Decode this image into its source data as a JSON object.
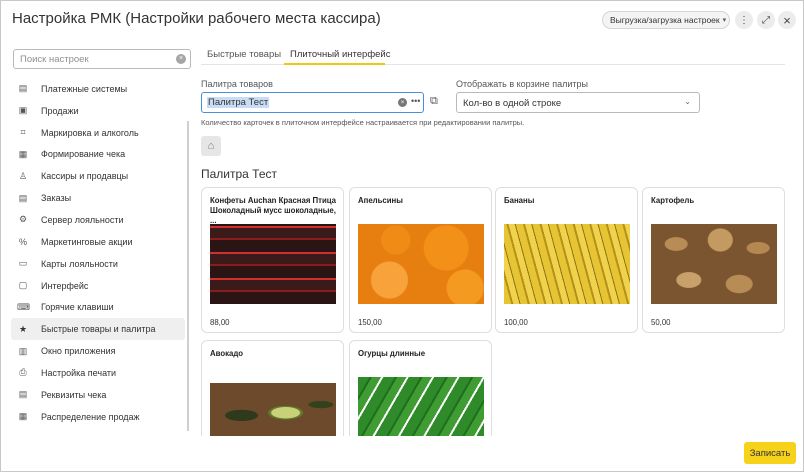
{
  "window": {
    "title": "Настройка РМК (Настройки рабочего места кассира)",
    "export_label": "Выгрузка/загрузка настроек",
    "more_icon": "more-vertical-icon",
    "expand_icon": "expand-icon",
    "close_icon": "close-icon"
  },
  "sidebar": {
    "search_placeholder": "Поиск настроек",
    "items": [
      {
        "label": "Платежные системы",
        "icon": "payment-systems-icon"
      },
      {
        "label": "Продажи",
        "icon": "sales-icon"
      },
      {
        "label": "Маркировка и алкоголь",
        "icon": "marking-icon"
      },
      {
        "label": "Формирование чека",
        "icon": "receipt-icon"
      },
      {
        "label": "Кассиры и продавцы",
        "icon": "cashiers-icon"
      },
      {
        "label": "Заказы",
        "icon": "orders-icon"
      },
      {
        "label": "Сервер лояльности",
        "icon": "gear-icon"
      },
      {
        "label": "Маркетинговые акции",
        "icon": "percent-icon"
      },
      {
        "label": "Карты лояльности",
        "icon": "card-icon"
      },
      {
        "label": "Интерфейс",
        "icon": "interface-icon"
      },
      {
        "label": "Горячие клавиши",
        "icon": "keyboard-icon"
      },
      {
        "label": "Быстрые товары и палитра",
        "icon": "star-icon"
      },
      {
        "label": "Окно приложения",
        "icon": "window-icon"
      },
      {
        "label": "Настройка печати",
        "icon": "printer-icon"
      },
      {
        "label": "Реквизиты чека",
        "icon": "receipt-details-icon"
      },
      {
        "label": "Распределение продаж",
        "icon": "distribution-icon"
      }
    ],
    "active_index": 11
  },
  "tabs": [
    {
      "label": "Быстрые товары"
    },
    {
      "label": "Плиточный интерфейс"
    }
  ],
  "form": {
    "palette_label": "Палитра товаров",
    "palette_value": "Палитра Тест",
    "display_label": "Отображать в корзине палитры",
    "display_value": "Кол-во в одной строке",
    "hint": "Количество карточек в плиточном интерфейсе настраивается при редактировании палитры."
  },
  "palette": {
    "title": "Палитра Тест",
    "cards": [
      {
        "name": "Конфеты Auchan Красная Птица Шоколадный мусс шоколадные, ...",
        "price": "88,00"
      },
      {
        "name": "Апельсины",
        "price": "150,00"
      },
      {
        "name": "Бананы",
        "price": "100,00"
      },
      {
        "name": "Картофель",
        "price": "50,00"
      },
      {
        "name": "Авокадо",
        "price": ""
      },
      {
        "name": "Огурцы длинные",
        "price": ""
      }
    ]
  },
  "footer": {
    "save_label": "Записать"
  },
  "colors": {
    "accent": "#f6d21a",
    "focus": "#4a8fd9"
  }
}
